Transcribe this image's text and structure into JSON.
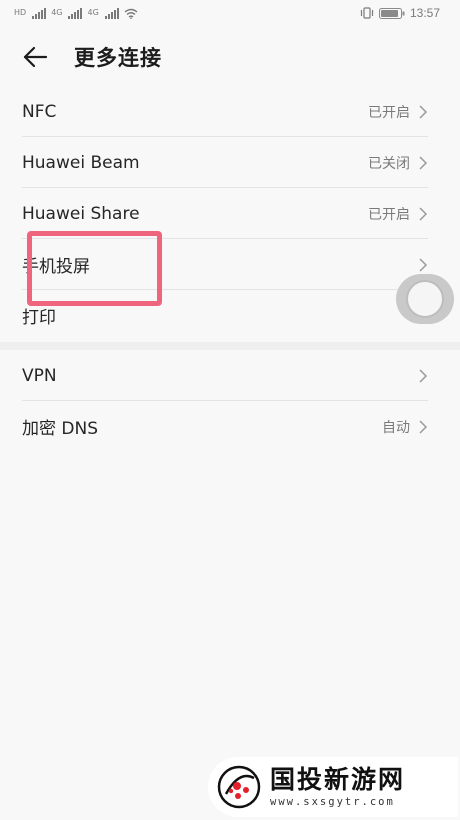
{
  "status_bar": {
    "sim1": "HD",
    "sim2": "4G",
    "sim3": "4G",
    "time": "13:57"
  },
  "header": {
    "title": "更多连接"
  },
  "settings_group_1": [
    {
      "label": "NFC",
      "value": "已开启"
    },
    {
      "label": "Huawei Beam",
      "value": "已关闭"
    },
    {
      "label": "Huawei Share",
      "value": "已开启"
    },
    {
      "label": "手机投屏",
      "value": ""
    },
    {
      "label": "打印",
      "value": ""
    }
  ],
  "settings_group_2": [
    {
      "label": "VPN",
      "value": ""
    },
    {
      "label": "加密 DNS",
      "value": "自动"
    }
  ],
  "watermark": {
    "name": "国投新游网",
    "url": "www.sxsgytr.com"
  },
  "colors": {
    "highlight": "#f0657e",
    "background": "#f8f8f8"
  }
}
